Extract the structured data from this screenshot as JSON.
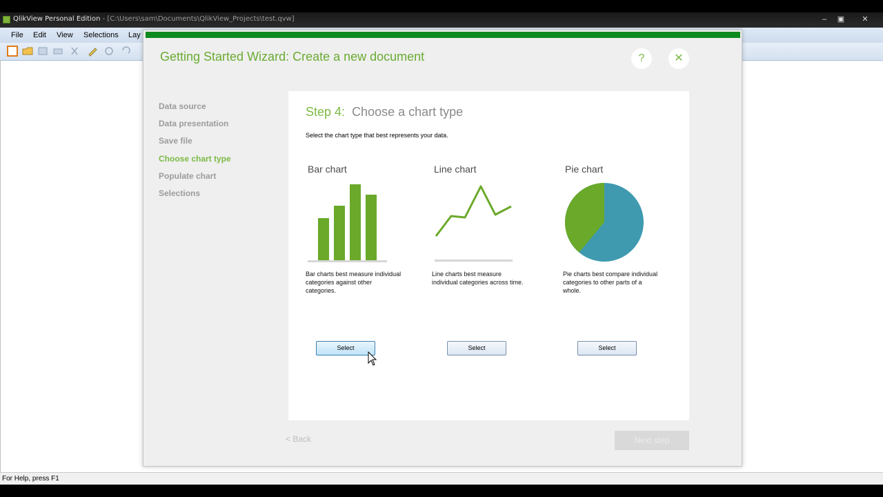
{
  "window": {
    "app_name": "QlikView Personal Edition",
    "path": "- [C:\\Users\\sam\\Documents\\QlikView_Projects\\test.qvw]",
    "min": "‒",
    "max": "▣",
    "close": "✕"
  },
  "menu": [
    "File",
    "Edit",
    "View",
    "Selections",
    "Lay"
  ],
  "wizard": {
    "title": "Getting Started Wizard: Create a new document",
    "help": "?",
    "close": "✕",
    "steps": [
      "Data source",
      "Data presentation",
      "Save file",
      "Choose chart type",
      "Populate chart",
      "Selections"
    ],
    "active_step": "Choose chart type",
    "heading_number": "Step 4:",
    "heading_text": "Choose a chart type",
    "instruction": "Select the chart type that best represents your data.",
    "options": [
      {
        "title": "Bar chart",
        "description": "Bar charts best measure individual categories against other categories.",
        "button": "Select"
      },
      {
        "title": "Line chart",
        "description": "Line charts best measure individual categories across time.",
        "button": "Select"
      },
      {
        "title": "Pie chart",
        "description": "Pie charts best compare individual categories to other parts of a whole.",
        "button": "Select"
      }
    ],
    "back": "< Back",
    "next": "Next step"
  },
  "status": "For Help, press F1",
  "colors": {
    "accent_green": "#7cba44",
    "pie_teal": "#3f9ab0",
    "title_bar_green": "#0d8a1f"
  }
}
